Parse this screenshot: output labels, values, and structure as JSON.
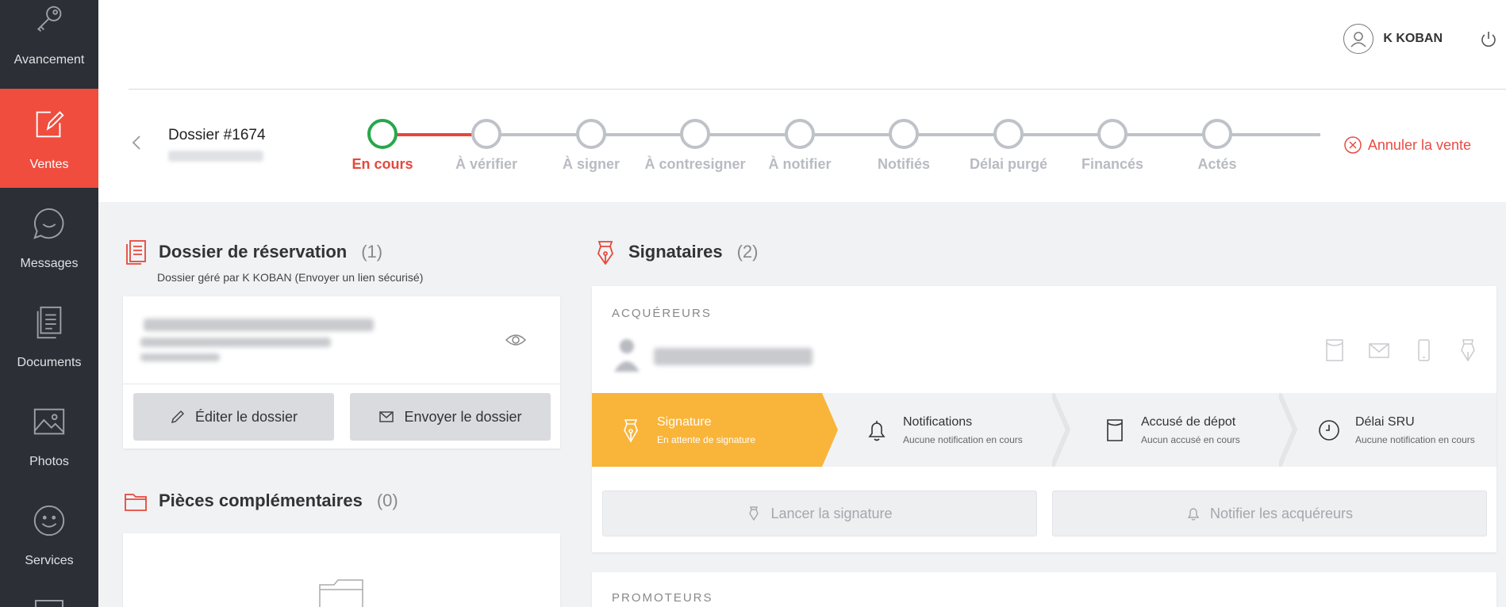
{
  "sidebar": {
    "items": [
      {
        "label": "Avancement",
        "icon": "key-icon"
      },
      {
        "label": "Ventes",
        "icon": "edit-icon"
      },
      {
        "label": "Messages",
        "icon": "chat-icon"
      },
      {
        "label": "Documents",
        "icon": "documents-icon"
      },
      {
        "label": "Photos",
        "icon": "photo-icon"
      },
      {
        "label": "Services",
        "icon": "smiley-icon"
      }
    ]
  },
  "header": {
    "user_name": "K KOBAN",
    "dossier_title": "Dossier #1674",
    "cancel_label": "Annuler la vente",
    "steps": [
      {
        "label": "En cours",
        "state": "current"
      },
      {
        "label": "À vérifier",
        "state": "pending"
      },
      {
        "label": "À signer",
        "state": "pending"
      },
      {
        "label": "À contresigner",
        "state": "pending"
      },
      {
        "label": "À notifier",
        "state": "pending"
      },
      {
        "label": "Notifiés",
        "state": "pending"
      },
      {
        "label": "Délai purgé",
        "state": "pending"
      },
      {
        "label": "Financés",
        "state": "pending"
      },
      {
        "label": "Actés",
        "state": "pending"
      }
    ]
  },
  "reservation": {
    "title": "Dossier de réservation",
    "count": "(1)",
    "subtitle": "Dossier géré par K KOBAN (Envoyer un lien sécurisé)",
    "edit_label": "Éditer le dossier",
    "send_label": "Envoyer le dossier"
  },
  "pieces": {
    "title": "Pièces complémentaires",
    "count": "(0)"
  },
  "signataires": {
    "title": "Signataires",
    "count": "(2)",
    "acquereurs_label": "ACQUÉREURS",
    "promoteurs_label": "PROMOTEURS",
    "status": [
      {
        "title": "Signature",
        "subtitle": "En attente de signature"
      },
      {
        "title": "Notifications",
        "subtitle": "Aucune notification en cours"
      },
      {
        "title": "Accusé de dépot",
        "subtitle": "Aucun accusé en cours"
      },
      {
        "title": "Délai SRU",
        "subtitle": "Aucune notification en cours"
      }
    ],
    "launch_label": "Lancer la signature",
    "notify_label": "Notifier les acquéreurs"
  },
  "colors": {
    "accent": "#f04d3e",
    "success": "#27a74b",
    "warning": "#f9b43a",
    "sidebar": "#2c3036"
  }
}
